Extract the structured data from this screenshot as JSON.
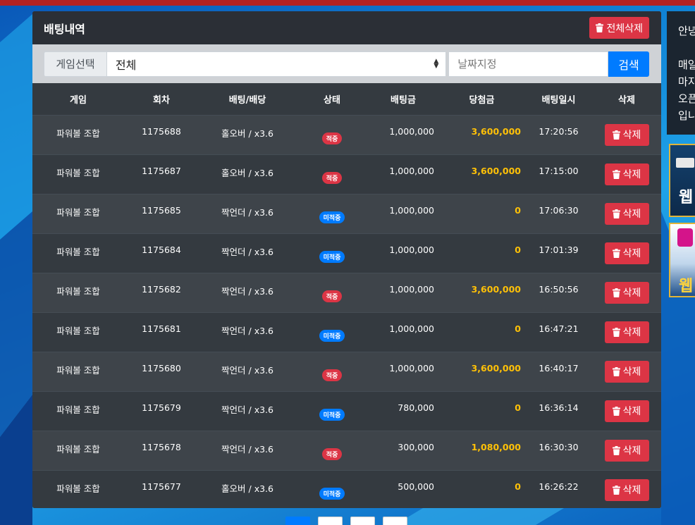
{
  "panel": {
    "title": "배팅내역",
    "delete_all_label": "전체삭제"
  },
  "filter": {
    "label": "게임선택",
    "selected": "전체",
    "date_placeholder": "날짜지정",
    "search_label": "검색"
  },
  "table": {
    "headers": [
      "게임",
      "회차",
      "배팅/배당",
      "상태",
      "배팅금",
      "당첨금",
      "배팅일시",
      "삭제"
    ],
    "delete_label": "삭제",
    "rows": [
      {
        "game": "파워볼 조합",
        "round": "1175688",
        "bet": "홀오버 / x3.6",
        "status": "적중",
        "amount": "1,000,000",
        "win": "3,600,000",
        "time": "17:20:56"
      },
      {
        "game": "파워볼 조합",
        "round": "1175687",
        "bet": "홀오버 / x3.6",
        "status": "적중",
        "amount": "1,000,000",
        "win": "3,600,000",
        "time": "17:15:00"
      },
      {
        "game": "파워볼 조합",
        "round": "1175685",
        "bet": "짝언더 / x3.6",
        "status": "미적중",
        "amount": "1,000,000",
        "win": "0",
        "time": "17:06:30"
      },
      {
        "game": "파워볼 조합",
        "round": "1175684",
        "bet": "짝언더 / x3.6",
        "status": "미적중",
        "amount": "1,000,000",
        "win": "0",
        "time": "17:01:39"
      },
      {
        "game": "파워볼 조합",
        "round": "1175682",
        "bet": "짝언더 / x3.6",
        "status": "적중",
        "amount": "1,000,000",
        "win": "3,600,000",
        "time": "16:50:56"
      },
      {
        "game": "파워볼 조합",
        "round": "1175681",
        "bet": "짝언더 / x3.6",
        "status": "미적중",
        "amount": "1,000,000",
        "win": "0",
        "time": "16:47:21"
      },
      {
        "game": "파워볼 조합",
        "round": "1175680",
        "bet": "짝언더 / x3.6",
        "status": "적중",
        "amount": "1,000,000",
        "win": "3,600,000",
        "time": "16:40:17"
      },
      {
        "game": "파워볼 조합",
        "round": "1175679",
        "bet": "짝언더 / x3.6",
        "status": "미적중",
        "amount": "780,000",
        "win": "0",
        "time": "16:36:14"
      },
      {
        "game": "파워볼 조합",
        "round": "1175678",
        "bet": "짝언더 / x3.6",
        "status": "적중",
        "amount": "300,000",
        "win": "1,080,000",
        "time": "16:30:30"
      },
      {
        "game": "파워볼 조합",
        "round": "1175677",
        "bet": "홀오버 / x3.6",
        "status": "미적중",
        "amount": "500,000",
        "win": "0",
        "time": "16:26:22"
      }
    ]
  },
  "notice": {
    "lines": [
      "안녕",
      "",
      "매일",
      "마지",
      "오픈",
      "입니"
    ]
  },
  "ads": {
    "ad1_text": "웹",
    "ad2_text": "웹"
  },
  "colors": {
    "hit": "#dc3545",
    "miss": "#007bff",
    "win_amount": "#ffc107",
    "accent": "#007bff"
  }
}
